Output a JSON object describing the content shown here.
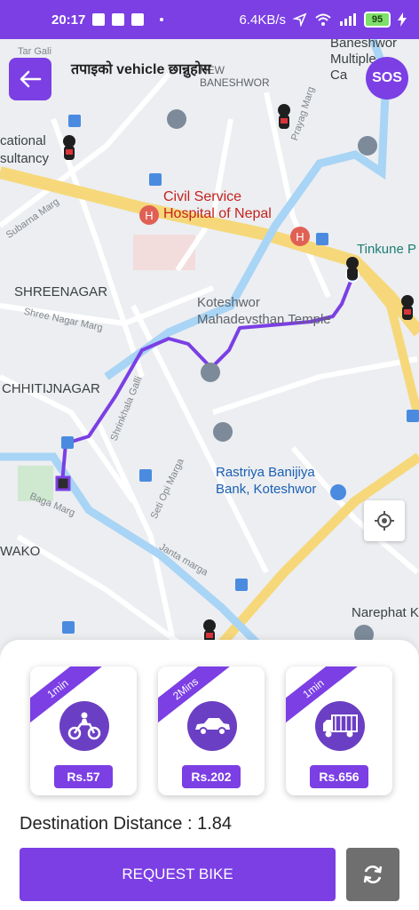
{
  "status_bar": {
    "time": "20:17",
    "network_speed": "6.4KB/s",
    "battery": "95"
  },
  "header": {
    "title": "तपाइको vehicle छान्नुहोस",
    "sos_label": "SOS"
  },
  "map": {
    "labels": {
      "baneshwor_multiple": "Baneshwor\nMultiple\nCa",
      "new_baneshwor": "NEW\nBANESHWOR",
      "educational": "cational\nsultancy",
      "civil_service": "Civil Service\nHospital of Nepal",
      "subarna": "Subarna Marg",
      "tinkune": "Tinkune P",
      "shreenagar": "SHREENAGAR",
      "shree_nagar_marg": "Shree Nagar Marg",
      "koteshwor_temple": "Koteshwor\nMahadevsthan Temple",
      "chhitijnagar": "CHHITIJNAGAR",
      "shrinkhala": "Shrinkhala Galli",
      "seti_opi": "Seti Opi Marga",
      "rastriya": "Rastriya Banijiya\nBank, Koteshwor",
      "baga_marg": "Baga Marg",
      "janta_marga": "Janta marga",
      "wako": "WAKO",
      "narephat": "Narephat K",
      "tar_gali": "Tar Gali",
      "prayag_marg": "Prayag Marg"
    }
  },
  "vehicles": [
    {
      "eta": "1min",
      "price": "Rs.57",
      "type": "motorbike-icon"
    },
    {
      "eta": "2Mins",
      "price": "Rs.202",
      "type": "car-icon"
    },
    {
      "eta": "1min",
      "price": "Rs.656",
      "type": "truck-icon"
    }
  ],
  "destination": {
    "label": "Destination Distance : ",
    "value": "1.84"
  },
  "actions": {
    "request_label": "REQUEST BIKE"
  },
  "colors": {
    "accent": "#7b3fe4",
    "route": "#7b3fe4"
  }
}
